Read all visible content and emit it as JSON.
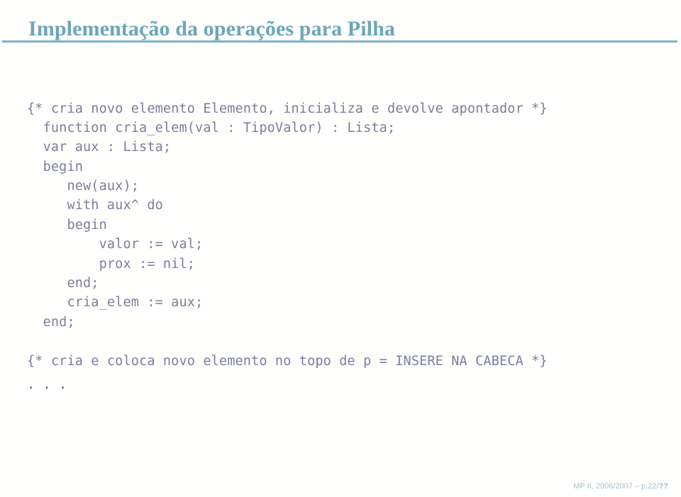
{
  "slide": {
    "title": "Implementação da operações para Pilha",
    "code_lines": [
      "{* cria novo elemento Elemento, inicializa e devolve apontador *}",
      "  function cria_elem(val : TipoValor) : Lista;",
      "  var aux : Lista;",
      "  begin",
      "     new(aux);",
      "     with aux^ do",
      "     begin",
      "         valor := val;",
      "         prox := nil;",
      "     end;",
      "     cria_elem := aux;",
      "  end;",
      "",
      "{* cria e coloca novo elemento no topo de p = INSERE NA CABECA *}"
    ],
    "ellipsis": ". . .",
    "footer": {
      "text": "MP II, 2006/2007 – p.22/",
      "page_unknown": "??"
    },
    "colors": {
      "title": "#6ba6b8",
      "rule": "#7fb3c4",
      "code": "#7a7e9b",
      "ellipsis": "#46476a",
      "footer": "#a8c2cc",
      "background": "#fffffd"
    }
  }
}
